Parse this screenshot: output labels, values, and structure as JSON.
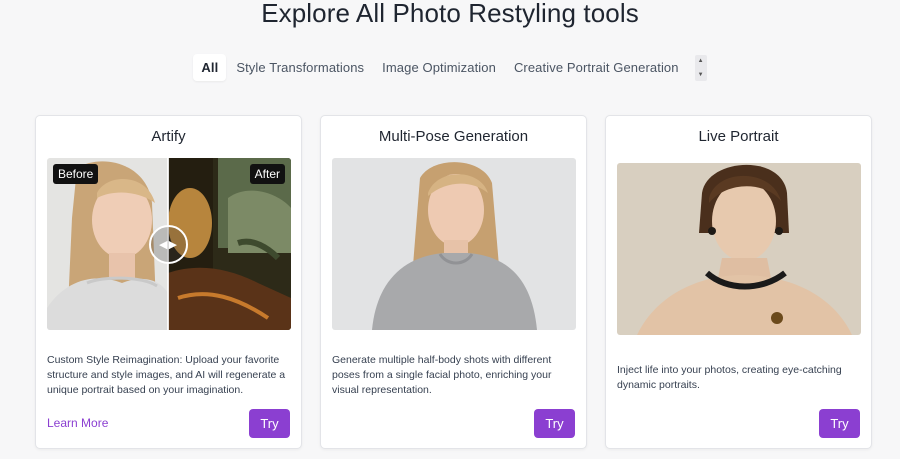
{
  "header": {
    "title": "Explore All Photo Restyling tools"
  },
  "tabs": [
    {
      "label": "All",
      "active": true
    },
    {
      "label": "Style Transformations",
      "active": false
    },
    {
      "label": "Image Optimization",
      "active": false
    },
    {
      "label": "Creative Portrait Generation",
      "active": false
    }
  ],
  "colors": {
    "accent": "#8b3fd1",
    "background": "#f7f7f8"
  },
  "cards": [
    {
      "title": "Artify",
      "before_label": "Before",
      "after_label": "After",
      "description": "Custom Style Reimagination: Upload your favorite structure and style images, and AI will regenerate a unique portrait based on your imagination.",
      "learn_more": "Learn More",
      "try_label": "Try"
    },
    {
      "title": "Multi-Pose Generation",
      "description": "Generate multiple half-body shots with different poses from a single facial photo, enriching your visual representation.",
      "try_label": "Try"
    },
    {
      "title": "Live Portrait",
      "description": "Inject life into your photos, creating eye-catching dynamic portraits.",
      "try_label": "Try"
    }
  ]
}
